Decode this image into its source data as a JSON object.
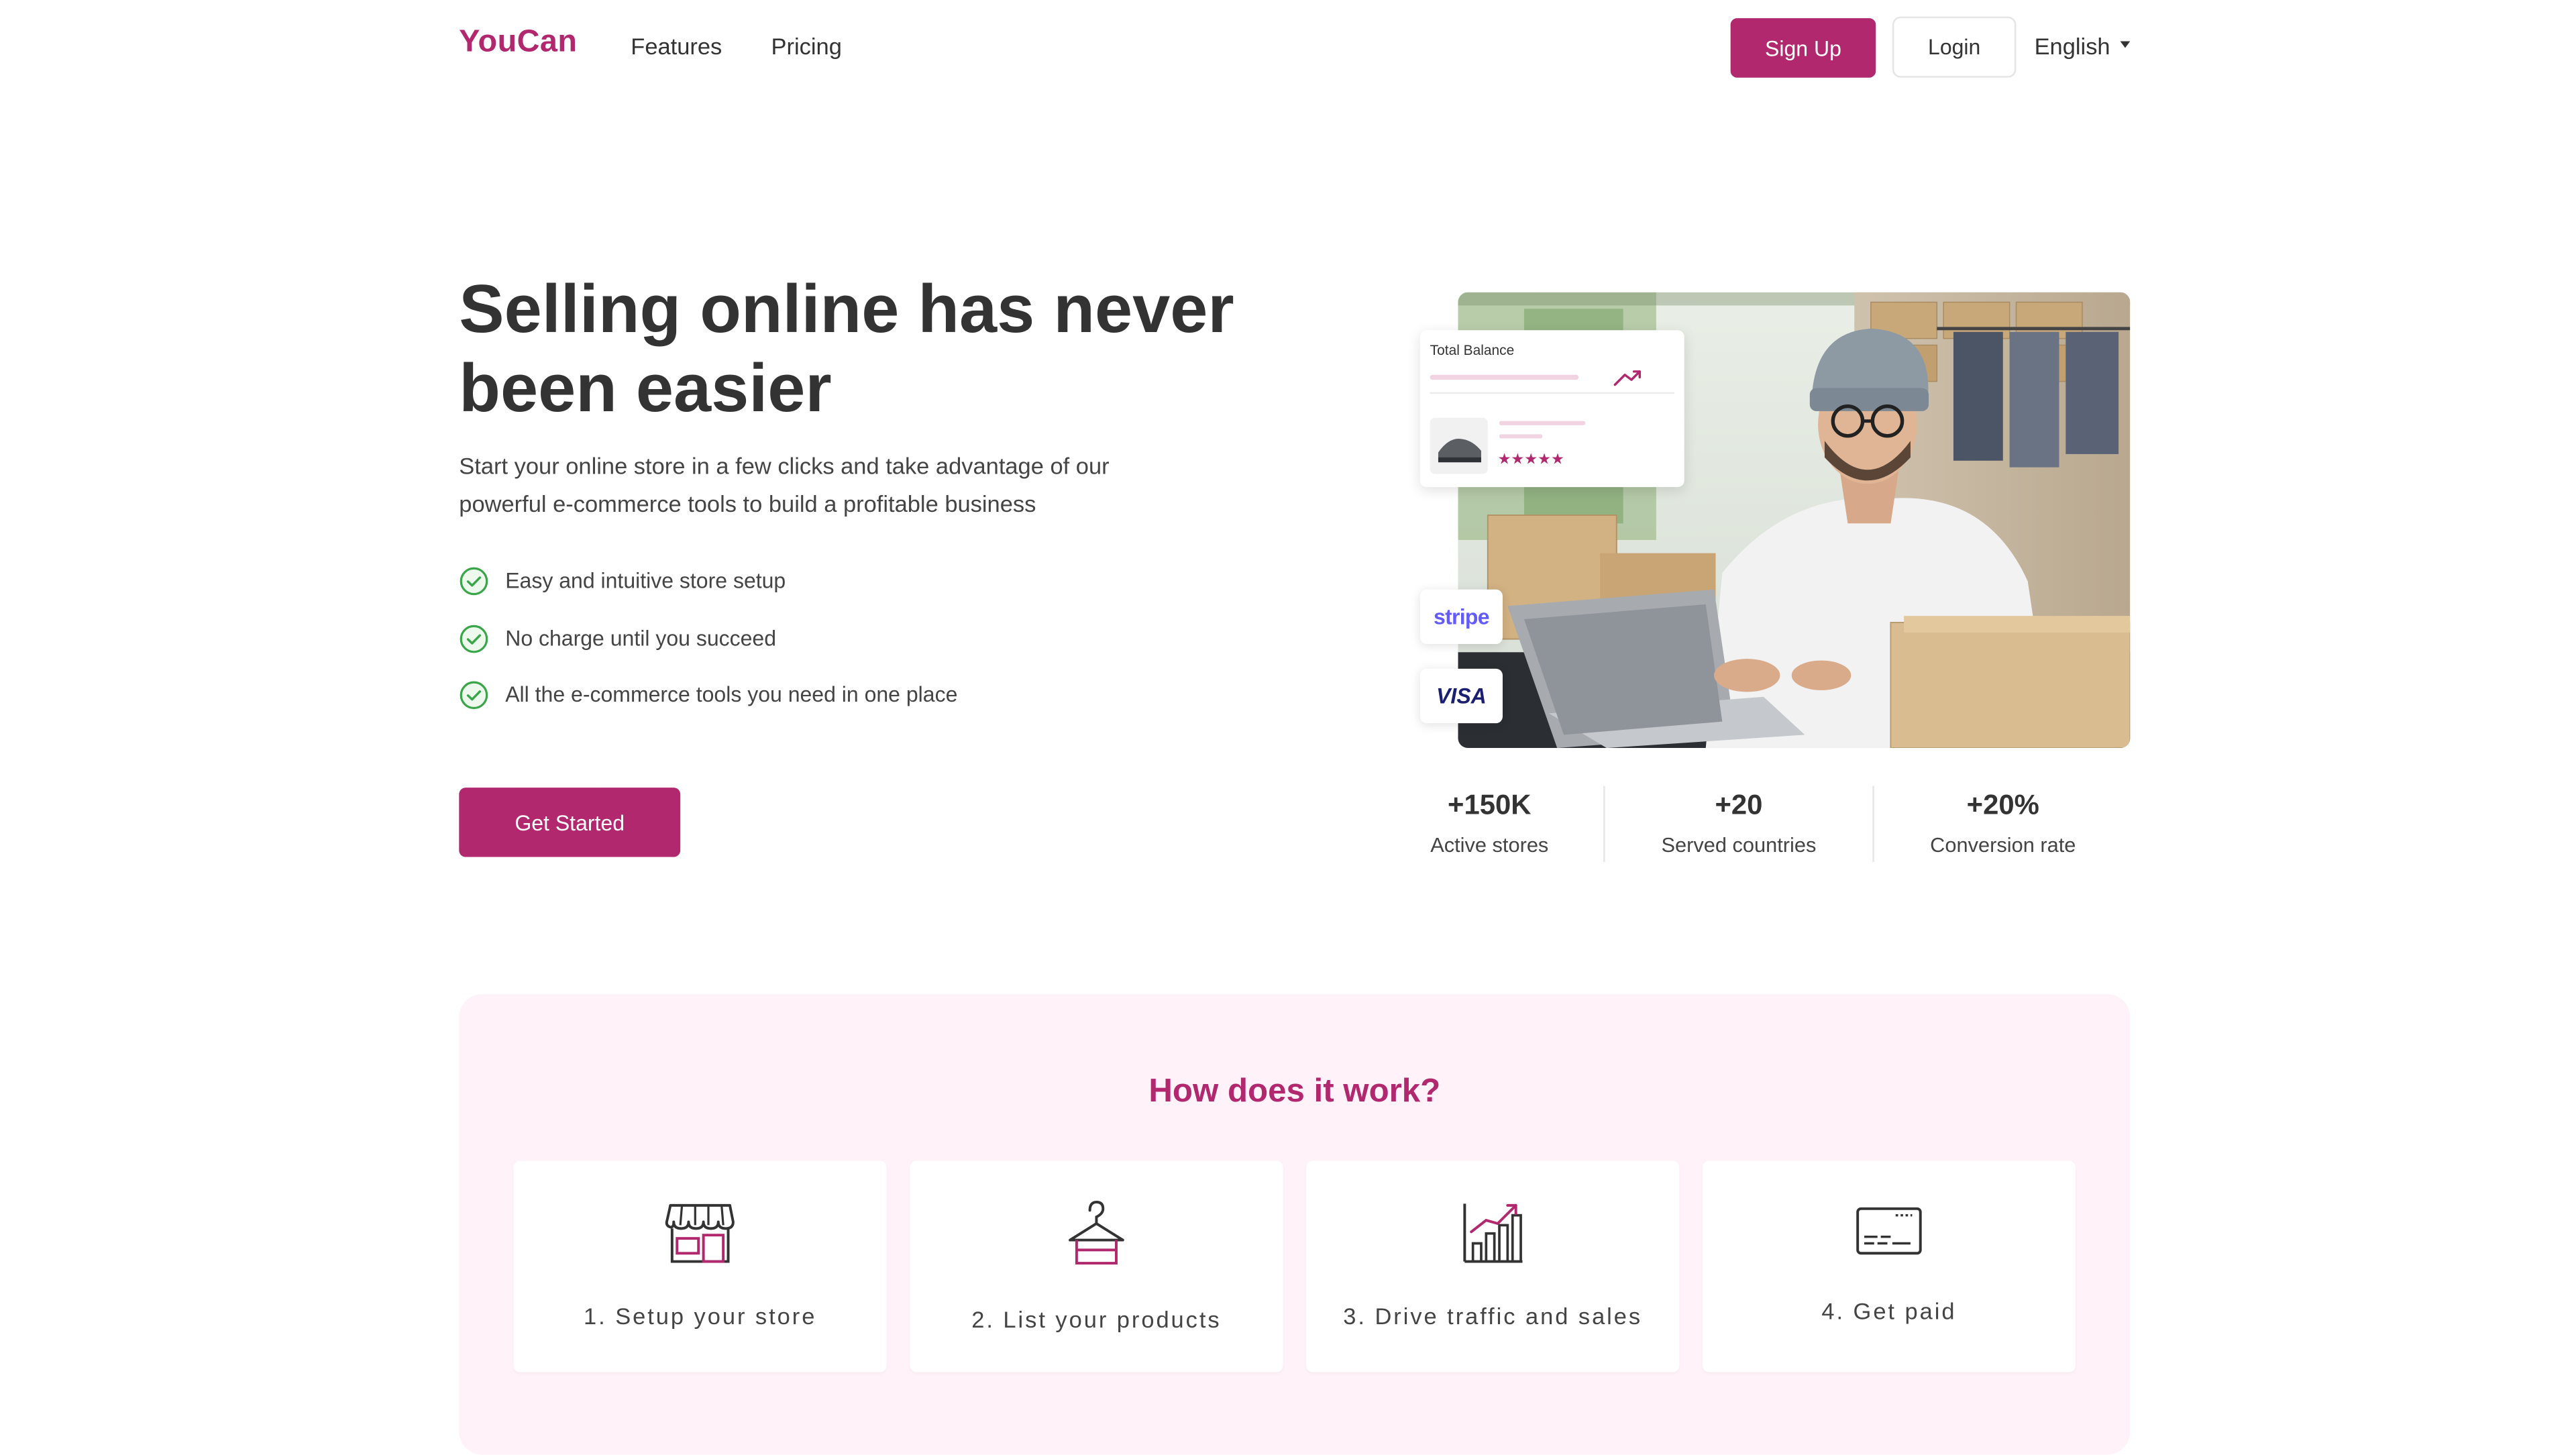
{
  "brand": {
    "name": "YouCan",
    "accent": "#b1286e",
    "soft_bg": "#fff2f8"
  },
  "nav": {
    "links": [
      "Features",
      "Pricing"
    ],
    "signup_label": "Sign Up",
    "login_label": "Login",
    "language": "English"
  },
  "hero": {
    "title": "Selling online has never been easier",
    "subtitle": "Start your online store in a few clicks and take advantage of our powerful e-commerce tools to build a profitable business",
    "features": [
      "Easy and intuitive store setup",
      "No charge until you succeed",
      "All the e-commerce tools you need in one place"
    ],
    "cta_label": "Get Started",
    "image_card": {
      "label": "Total Balance"
    },
    "payment_badges": [
      "stripe",
      "VISA"
    ]
  },
  "stats": [
    {
      "value": "+150K",
      "label": "Active stores"
    },
    {
      "value": "+20",
      "label": "Served countries"
    },
    {
      "value": "+20%",
      "label": "Conversion rate"
    }
  ],
  "how": {
    "title": "How does it work?",
    "steps": [
      {
        "label": "1. Setup your store",
        "icon": "storefront-icon"
      },
      {
        "label": "2. List your products",
        "icon": "hanger-icon"
      },
      {
        "label": "3. Drive traffic and sales",
        "icon": "growth-chart-icon"
      },
      {
        "label": "4. Get paid",
        "icon": "payment-card-icon"
      }
    ]
  }
}
